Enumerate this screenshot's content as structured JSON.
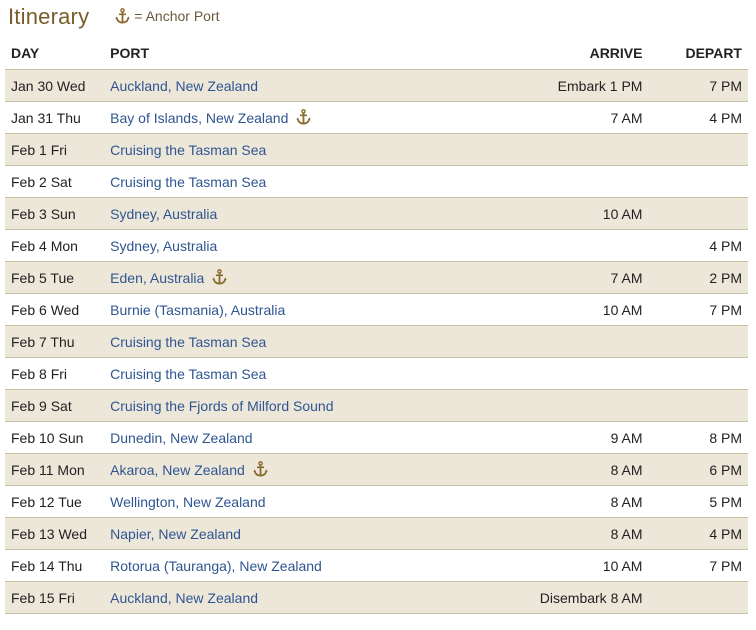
{
  "title": "Itinerary",
  "legend": {
    "text": "= Anchor Port",
    "icon": "anchor-icon"
  },
  "colors": {
    "title": "#7a5c2a",
    "link": "#2f5590",
    "row_alt": "#ede7da",
    "divider": "#c9bfa3",
    "anchor": "#8a6a2c"
  },
  "columns": {
    "day": "DAY",
    "port": "PORT",
    "arrive": "ARRIVE",
    "depart": "DEPART"
  },
  "rows": [
    {
      "day": "Jan 30 Wed",
      "port": "Auckland, New Zealand",
      "anchor": false,
      "arrive": "Embark 1 PM",
      "depart": "7 PM"
    },
    {
      "day": "Jan 31 Thu",
      "port": "Bay of Islands, New Zealand",
      "anchor": true,
      "arrive": "7 AM",
      "depart": "4 PM"
    },
    {
      "day": "Feb 1 Fri",
      "port": "Cruising the Tasman Sea",
      "anchor": false,
      "arrive": "",
      "depart": ""
    },
    {
      "day": "Feb 2 Sat",
      "port": "Cruising the Tasman Sea",
      "anchor": false,
      "arrive": "",
      "depart": ""
    },
    {
      "day": "Feb 3 Sun",
      "port": "Sydney, Australia",
      "anchor": false,
      "arrive": "10 AM",
      "depart": ""
    },
    {
      "day": "Feb 4 Mon",
      "port": "Sydney, Australia",
      "anchor": false,
      "arrive": "",
      "depart": "4 PM"
    },
    {
      "day": "Feb 5 Tue",
      "port": "Eden, Australia",
      "anchor": true,
      "arrive": "7 AM",
      "depart": "2 PM"
    },
    {
      "day": "Feb 6 Wed",
      "port": "Burnie (Tasmania), Australia",
      "anchor": false,
      "arrive": "10 AM",
      "depart": "7 PM"
    },
    {
      "day": "Feb 7 Thu",
      "port": "Cruising the Tasman Sea",
      "anchor": false,
      "arrive": "",
      "depart": ""
    },
    {
      "day": "Feb 8 Fri",
      "port": "Cruising the Tasman Sea",
      "anchor": false,
      "arrive": "",
      "depart": ""
    },
    {
      "day": "Feb 9 Sat",
      "port": "Cruising the Fjords of Milford Sound",
      "anchor": false,
      "arrive": "",
      "depart": ""
    },
    {
      "day": "Feb 10 Sun",
      "port": "Dunedin, New Zealand",
      "anchor": false,
      "arrive": "9 AM",
      "depart": "8 PM"
    },
    {
      "day": "Feb 11 Mon",
      "port": "Akaroa, New Zealand",
      "anchor": true,
      "arrive": "8 AM",
      "depart": "6 PM"
    },
    {
      "day": "Feb 12 Tue",
      "port": "Wellington, New Zealand",
      "anchor": false,
      "arrive": "8 AM",
      "depart": "5 PM"
    },
    {
      "day": "Feb 13 Wed",
      "port": "Napier, New Zealand",
      "anchor": false,
      "arrive": "8 AM",
      "depart": "4 PM"
    },
    {
      "day": "Feb 14 Thu",
      "port": "Rotorua (Tauranga), New Zealand",
      "anchor": false,
      "arrive": "10 AM",
      "depart": "7 PM"
    },
    {
      "day": "Feb 15 Fri",
      "port": "Auckland, New Zealand",
      "anchor": false,
      "arrive": "Disembark 8 AM",
      "depart": ""
    }
  ]
}
